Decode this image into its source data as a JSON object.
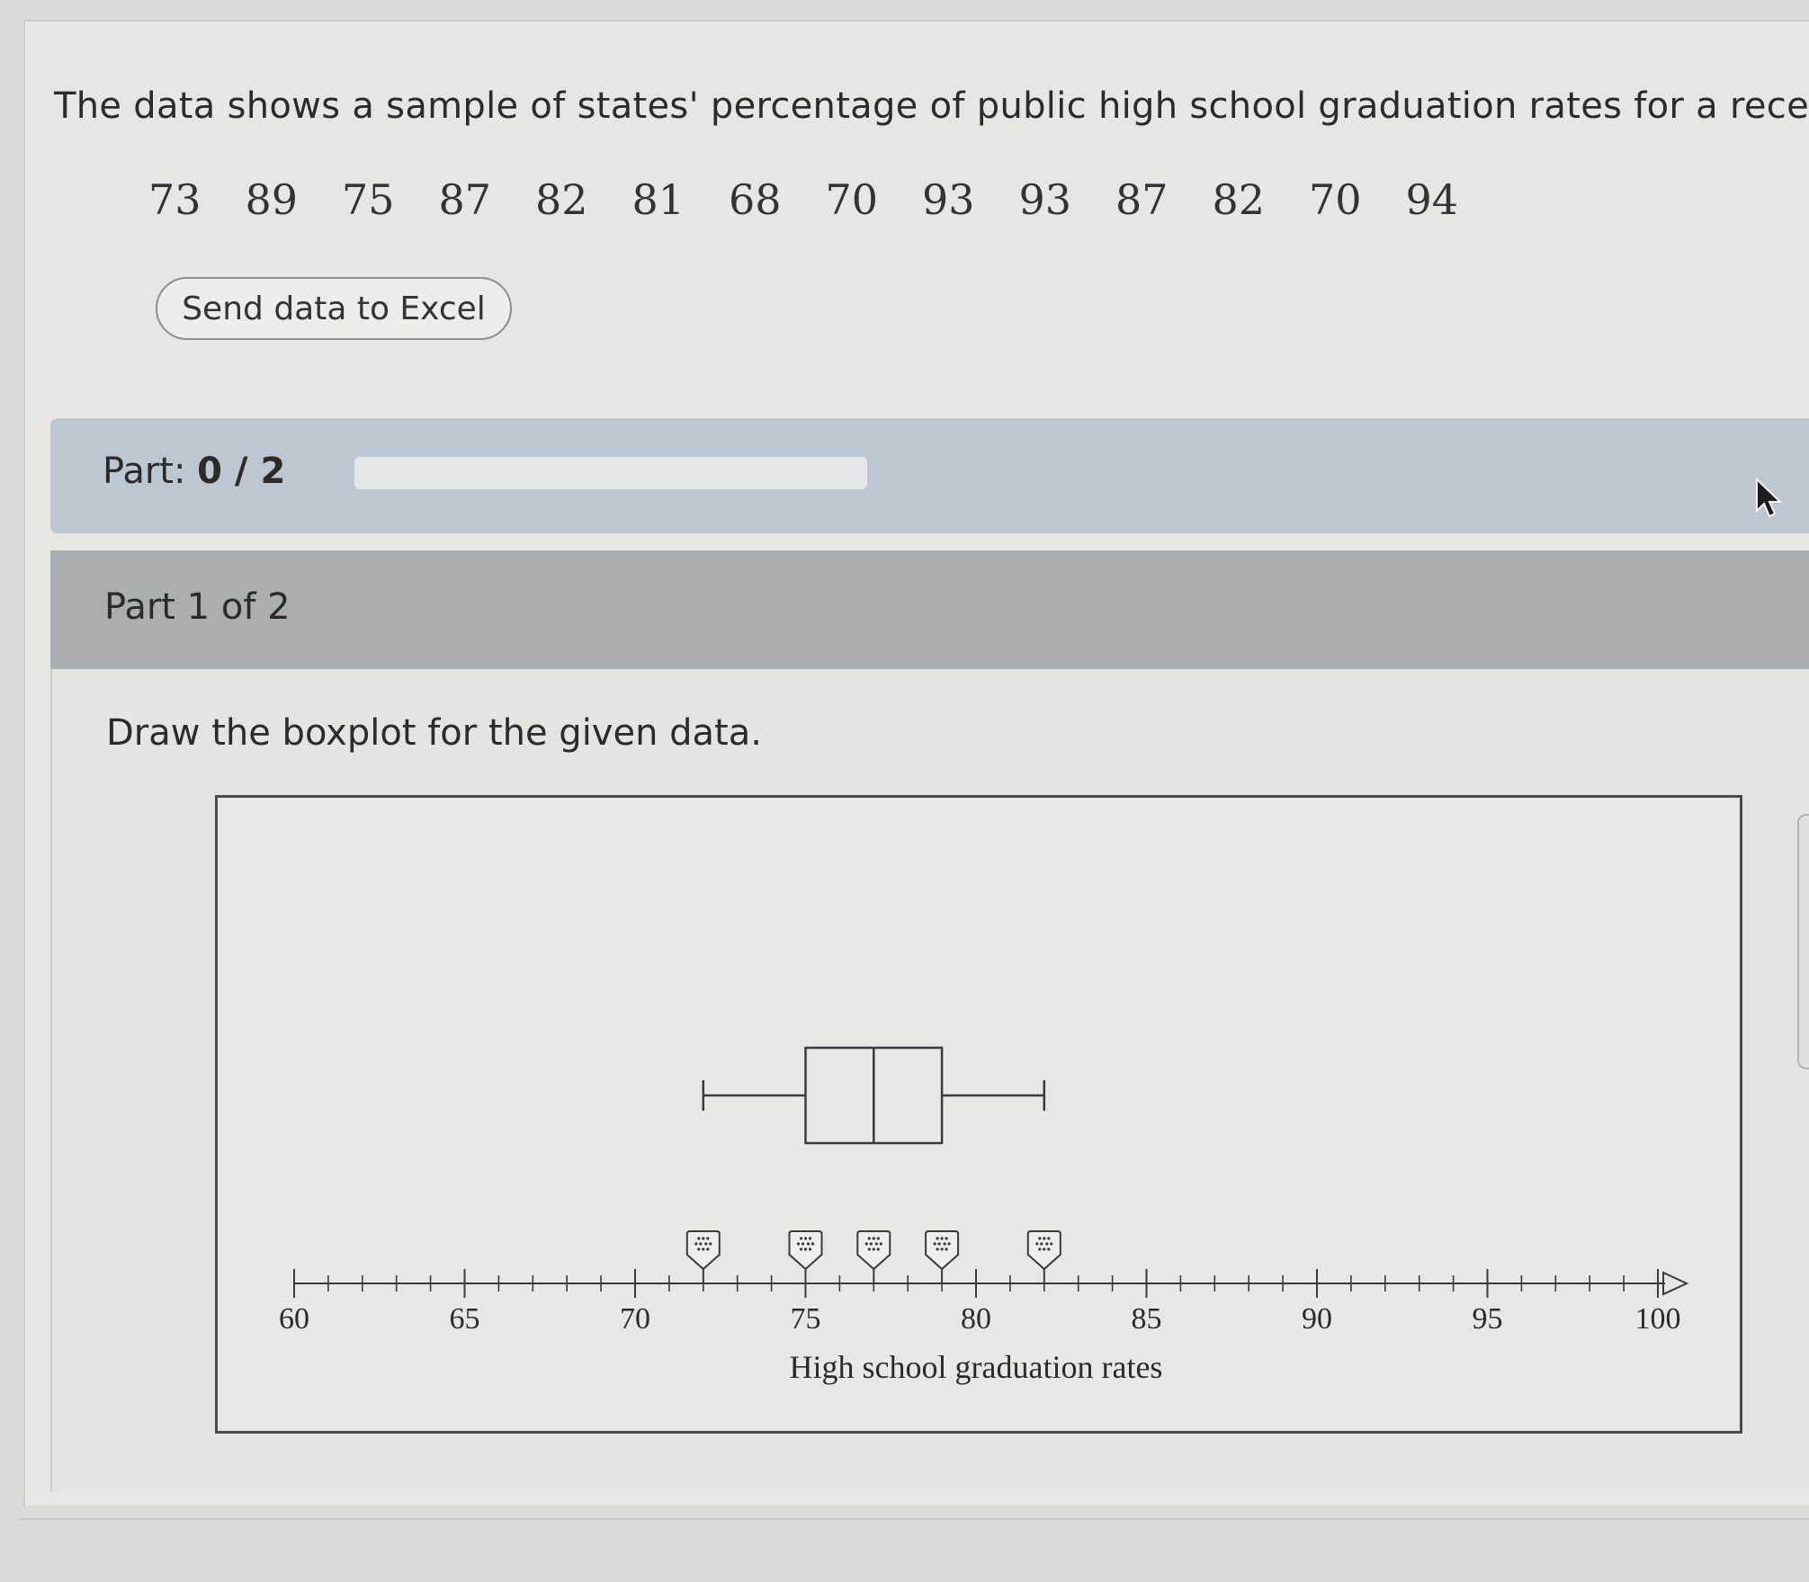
{
  "problem": {
    "statement": "The data shows a sample of states' percentage of public high school graduation rates for a recent",
    "data_values": [
      "73",
      "89",
      "75",
      "87",
      "82",
      "81",
      "68",
      "70",
      "93",
      "93",
      "87",
      "82",
      "70",
      "94"
    ],
    "excel_button_label": "Send data to Excel"
  },
  "progress": {
    "part_prefix": "Part:",
    "part_value": "0 / 2",
    "completed_fraction": 0
  },
  "part1": {
    "header": "Part 1 of 2",
    "instruction": "Draw the boxplot for the given data."
  },
  "colors": {
    "page_background": "#e8e6e3",
    "progress_bar_background": "#bcc7d1",
    "part_header_background": "#a9aeb0",
    "plot_ink": "#3a3a3a"
  },
  "icons": {
    "cursor": "cursor-arrow-icon",
    "handle": "drag-handle-icon"
  },
  "chart_data": {
    "type": "boxplot",
    "xlabel": "High school graduation rates",
    "xlim": [
      60,
      100
    ],
    "major_ticks": [
      60,
      65,
      70,
      75,
      80,
      85,
      90,
      95,
      100
    ],
    "tick_labels": [
      "60",
      "65",
      "70",
      "75",
      "80",
      "85",
      "90",
      "95",
      "100"
    ],
    "minor_tick_step": 1,
    "boxplot": {
      "min": 72,
      "q1": 75,
      "median": 77,
      "q3": 79,
      "max": 82
    },
    "handles": [
      72,
      75,
      77,
      79,
      82
    ]
  }
}
